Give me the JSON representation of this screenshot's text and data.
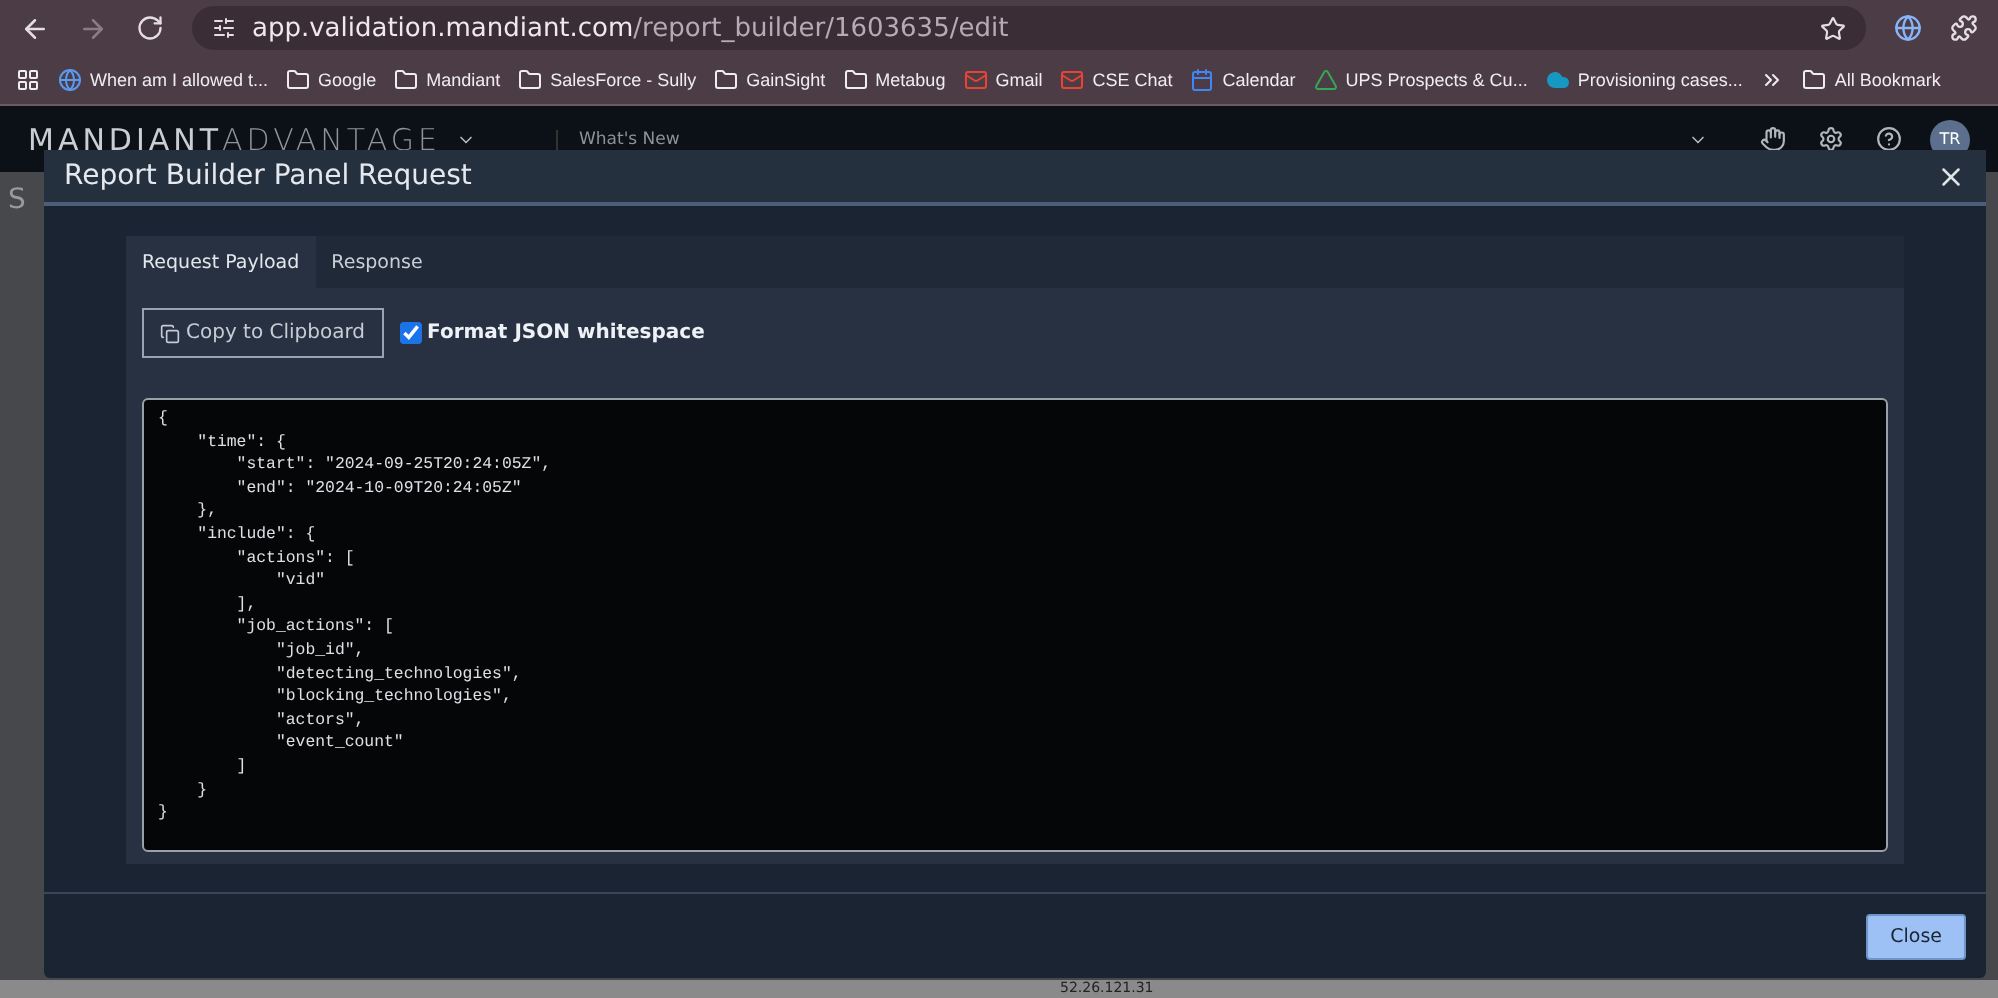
{
  "browser": {
    "url_host": "app.validation.mandiant.com",
    "url_path": "/report_builder/1603635/edit",
    "bookmarks": [
      {
        "label": "When am I allowed t...",
        "kind": "site"
      },
      {
        "label": "Google",
        "kind": "folder"
      },
      {
        "label": "Mandiant",
        "kind": "folder"
      },
      {
        "label": "SalesForce - Sully",
        "kind": "folder"
      },
      {
        "label": "GainSight",
        "kind": "folder"
      },
      {
        "label": "Metabug",
        "kind": "folder"
      },
      {
        "label": "Gmail",
        "kind": "mail"
      },
      {
        "label": "CSE Chat",
        "kind": "mail"
      },
      {
        "label": "Calendar",
        "kind": "calendar"
      },
      {
        "label": "UPS Prospects & Cu...",
        "kind": "drive"
      },
      {
        "label": "Provisioning cases...",
        "kind": "cloud"
      }
    ],
    "all_bookmarks": "All Bookmark"
  },
  "app": {
    "brand_bold": "MANDIANT",
    "brand_light": "ADVANTAGE",
    "nav_item": "What's New",
    "avatar": "TR",
    "behind_text": "S",
    "behind_cell": "52.26.121.31"
  },
  "modal": {
    "title": "Report Builder Panel Request",
    "tabs": [
      {
        "label": "Request Payload",
        "selected": true
      },
      {
        "label": "Response",
        "selected": false
      }
    ],
    "copy_button": "Copy to Clipboard",
    "format_option": {
      "label": "Format JSON whitespace",
      "checked": true
    },
    "code": "{\n    \"time\": {\n        \"start\": \"2024-09-25T20:24:05Z\",\n        \"end\": \"2024-10-09T20:24:05Z\"\n    },\n    \"include\": {\n        \"actions\": [\n            \"vid\"\n        ],\n        \"job_actions\": [\n            \"job_id\",\n            \"detecting_technologies\",\n            \"blocking_technologies\",\n            \"actors\",\n            \"event_count\"\n        ]\n    }\n}",
    "close_button": "Close"
  }
}
